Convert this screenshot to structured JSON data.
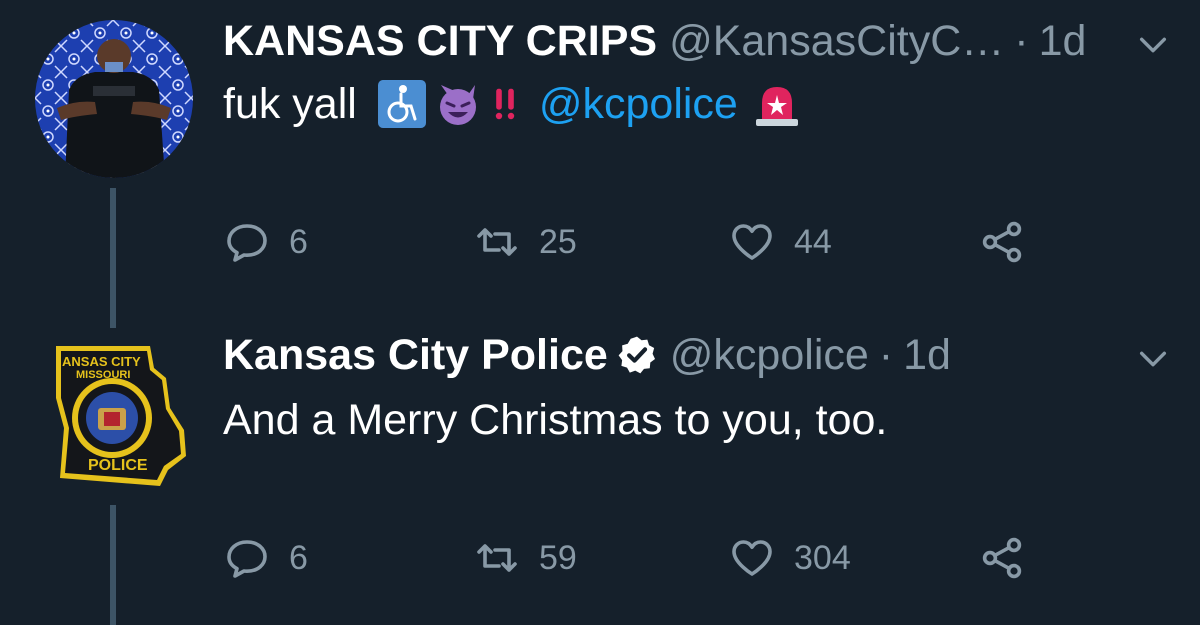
{
  "tweets": [
    {
      "display_name": "KANSAS CITY CRIPS",
      "handle": "@KansasCityC…",
      "separator": "·",
      "time": "1d",
      "text": "fuk yall",
      "emojis": [
        "wheelchair-emoji",
        "smiling-imp-emoji",
        "double-exclamation-emoji"
      ],
      "mention": "@kcpolice",
      "trailing_emoji": "police-light-emoji",
      "replies": "6",
      "retweets": "25",
      "likes": "44"
    },
    {
      "display_name": "Kansas City Police",
      "verified": true,
      "handle": "@kcpolice",
      "separator": "·",
      "time": "1d",
      "text": "And a Merry Christmas to you, too.",
      "replies": "6",
      "retweets": "59",
      "likes": "304",
      "avatar_badge": {
        "top_text": "ANSAS CITY",
        "sub_text": "MISSOURI",
        "bottom_text": "POLICE"
      }
    }
  ],
  "colors": {
    "background": "#15202b",
    "text": "#ffffff",
    "secondary": "#8899a6",
    "link": "#1da1f2",
    "thread_line": "#3d5466"
  }
}
